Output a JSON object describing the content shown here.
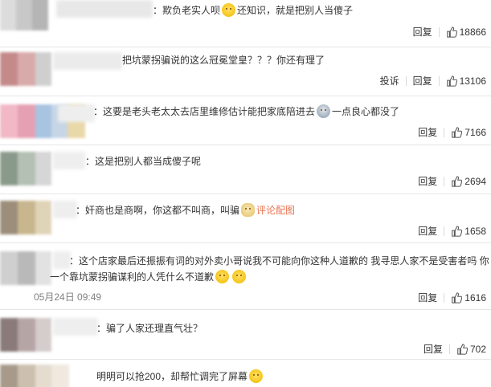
{
  "labels": {
    "reply": "回复",
    "report": "投诉"
  },
  "comments": [
    {
      "text_prefix": "：欺负老实人呗",
      "text_suffix": "还知识，就是把别人当傻子",
      "likes": "18866"
    },
    {
      "text": "把坑蒙拐骗说的这么冠冕堂皇？？？你还有理了",
      "likes": "13106"
    },
    {
      "text_prefix": "：这要是老头老太太去店里维修估计能把家底陪进去",
      "text_suffix": "一点良心都没了",
      "likes": "7166"
    },
    {
      "text": "：这是把别人都当成傻子呢",
      "likes": "2694"
    },
    {
      "text_prefix": "：奸商也是商啊，你这都不叫商，叫骗",
      "link": "评论配图",
      "likes": "1658"
    },
    {
      "line1": "：这个店家最后还振振有词的对外卖小哥说我不可能向你这种人道歉的 我寻思人家不是受害者吗 你",
      "line2": "一个靠坑蒙拐骗谋利的人凭什么不道歉",
      "time": "05月24日 09:49",
      "likes": "1616"
    },
    {
      "text": "：骗了人家还理直气壮？",
      "likes": "702"
    },
    {
      "text": "明明可以抢200，却帮忙调完了屏幕"
    }
  ],
  "colors": {
    "link": "#eb7350",
    "meta": "#808080",
    "text": "#333333"
  }
}
